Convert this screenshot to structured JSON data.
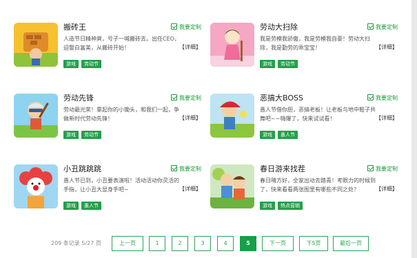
{
  "cards": [
    {
      "title": "搬砖王",
      "custom_label": "我要定制",
      "desc": "人造节日精神爽，号子一喊搬砖去。出任CEO，迎娶白富美，从搬砖开始！",
      "detail": "【详细】",
      "tags": [
        "游戏",
        "劳动节"
      ]
    },
    {
      "title": "劳动大扫除",
      "custom_label": "我要定制",
      "desc": "我是劳模我骄傲，我是劳模我自豪！劳动大扫除，我是勤劳的乖宝宝！",
      "detail": "【详细】",
      "tags": [
        "游戏",
        "劳动节"
      ]
    },
    {
      "title": "劳动先锋",
      "custom_label": "我要定制",
      "desc": "劳动最光荣！拿起你的小锄头，和我们一起，争做新时代劳动先锋！",
      "detail": "【详细】",
      "tags": [
        "游戏",
        "劳动节"
      ]
    },
    {
      "title": "恶搞大BOSS",
      "custom_label": "我要定制",
      "desc": "愚人节借你胆，恶搞老板！让老板与地中鞋子共舞吧~~嗨爆了，快来试试看！",
      "detail": "【详细】",
      "tags": [
        "游戏",
        "愚人节"
      ]
    },
    {
      "title": "小丑跳跳跳",
      "custom_label": "我要定制",
      "desc": "愚人节已到，小丑要表演啦！活动活动你灵活的手指，让小丑大显身手吧~",
      "detail": "【详细】",
      "tags": [
        "游戏",
        "愚人节"
      ]
    },
    {
      "title": "春日游来找茬",
      "custom_label": "我要定制",
      "desc": "春日晴方好，全家出动去踏青！考眼力的时候到了，快来看看两张图里有哪些不同之处？",
      "detail": "【详细】",
      "tags": [
        "游戏",
        "热点营销"
      ]
    }
  ],
  "pager": {
    "records": "209 条记录 5/27 页",
    "prev": "上一页",
    "pages": [
      "1",
      "2",
      "3",
      "4",
      "5"
    ],
    "current": "5",
    "next": "下一页",
    "next5": "下5页",
    "last": "最后一页"
  },
  "colors": {
    "accent": "#21a04a",
    "custom_text": "#1a9a39"
  },
  "icons": {
    "custom": "check-square-icon"
  }
}
